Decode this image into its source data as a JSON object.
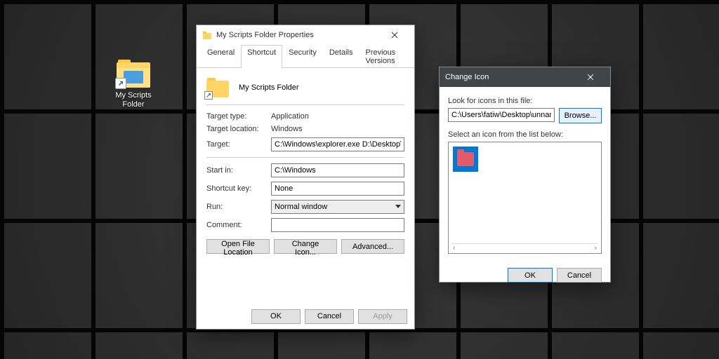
{
  "desktop": {
    "shortcut_label": "My Scripts Folder"
  },
  "props": {
    "title": "My Scripts Folder Properties",
    "tabs": {
      "general": "General",
      "shortcut": "Shortcut",
      "security": "Security",
      "details": "Details",
      "previous": "Previous Versions"
    },
    "header_name": "My Scripts Folder",
    "labels": {
      "target_type": "Target type:",
      "target_type_val": "Application",
      "target_location": "Target location:",
      "target_location_val": "Windows",
      "target": "Target:",
      "target_val": "C:\\Windows\\explorer.exe D:\\Desktop\\Scripts",
      "start_in": "Start in:",
      "start_in_val": "C:\\Windows",
      "shortcut_key": "Shortcut key:",
      "shortcut_key_val": "None",
      "run": "Run:",
      "run_val": "Normal window",
      "comment": "Comment:",
      "comment_val": ""
    },
    "buttons": {
      "open_loc": "Open File Location",
      "change_icon": "Change Icon...",
      "advanced": "Advanced..."
    },
    "footer": {
      "ok": "OK",
      "cancel": "Cancel",
      "apply": "Apply"
    }
  },
  "chg": {
    "title": "Change Icon",
    "look_label": "Look for icons in this file:",
    "path_val": "C:\\Users\\fatiw\\Desktop\\unnamed_cy",
    "browse": "Browse...",
    "select_label": "Select an icon from the list below:",
    "ok": "OK",
    "cancel": "Cancel"
  }
}
